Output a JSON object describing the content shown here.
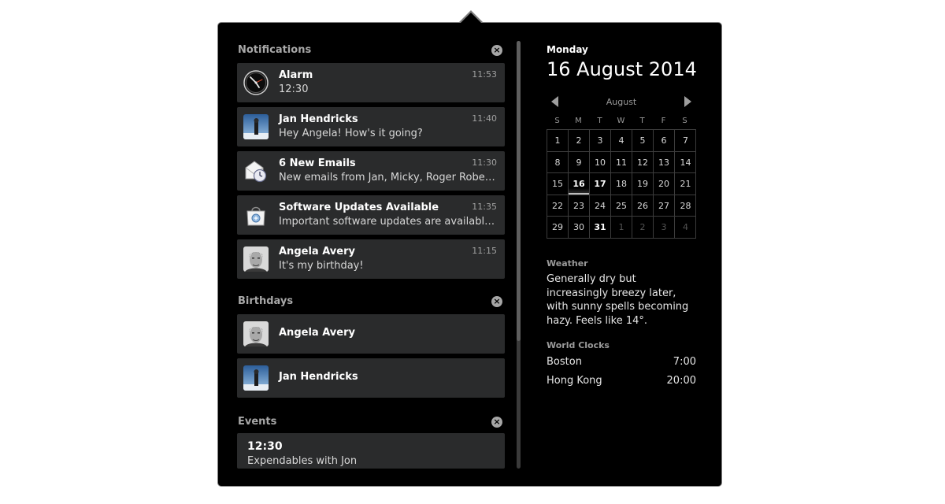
{
  "notifications": {
    "title": "Notifications",
    "clear_label": "×",
    "items": [
      {
        "title": "Alarm",
        "body": "12:30",
        "time": "11:53",
        "icon": "clock-icon"
      },
      {
        "title": "Jan Hendricks",
        "body": "Hey Angela! How's it going?",
        "time": "11:40",
        "icon": "avatar-jan"
      },
      {
        "title": "6 New Emails",
        "body": "New emails from Jan, Micky, Roger Roberts",
        "time": "11:30",
        "icon": "mail-icon"
      },
      {
        "title": "Software Updates Available",
        "body": "Important software updates are available to install",
        "time": "11:35",
        "icon": "software-bag-icon"
      },
      {
        "title": "Angela Avery",
        "body": "It's my birthday!",
        "time": "11:15",
        "icon": "avatar-angela"
      }
    ]
  },
  "birthdays": {
    "title": "Birthdays",
    "clear_label": "×",
    "items": [
      {
        "name": "Angela Avery",
        "icon": "avatar-angela"
      },
      {
        "name": "Jan Hendricks",
        "icon": "avatar-jan"
      }
    ]
  },
  "events": {
    "title": "Events",
    "clear_label": "×",
    "items": [
      {
        "time": "12:30",
        "title": "Expendables with Jon"
      }
    ]
  },
  "date": {
    "weekday": "Monday",
    "full": "16 August 2014"
  },
  "calendar": {
    "month": "August",
    "weekdays": [
      "S",
      "M",
      "T",
      "W",
      "T",
      "F",
      "S"
    ],
    "weeks": [
      [
        "1",
        "2",
        "3",
        "4",
        "5",
        "6",
        "7"
      ],
      [
        "8",
        "9",
        "10",
        "11",
        "12",
        "13",
        "14"
      ],
      [
        "15",
        "16",
        "17",
        "18",
        "19",
        "20",
        "21"
      ],
      [
        "22",
        "23",
        "24",
        "25",
        "26",
        "27",
        "28"
      ],
      [
        "29",
        "30",
        "31",
        "1",
        "2",
        "3",
        "4"
      ]
    ],
    "today": "16",
    "event_days": [
      "17",
      "31"
    ]
  },
  "weather": {
    "title": "Weather",
    "text": "Generally dry but increasingly breezy later, with sunny spells becoming hazy. Feels like 14°."
  },
  "world_clocks": {
    "title": "World Clocks",
    "items": [
      {
        "city": "Boston",
        "time": "7:00"
      },
      {
        "city": "Hong Kong",
        "time": "20:00"
      }
    ]
  },
  "colors": {
    "background": "#000000",
    "card": "#2a2b2c",
    "border": "#7f7f7f",
    "muted_text": "#9a9a9a"
  }
}
